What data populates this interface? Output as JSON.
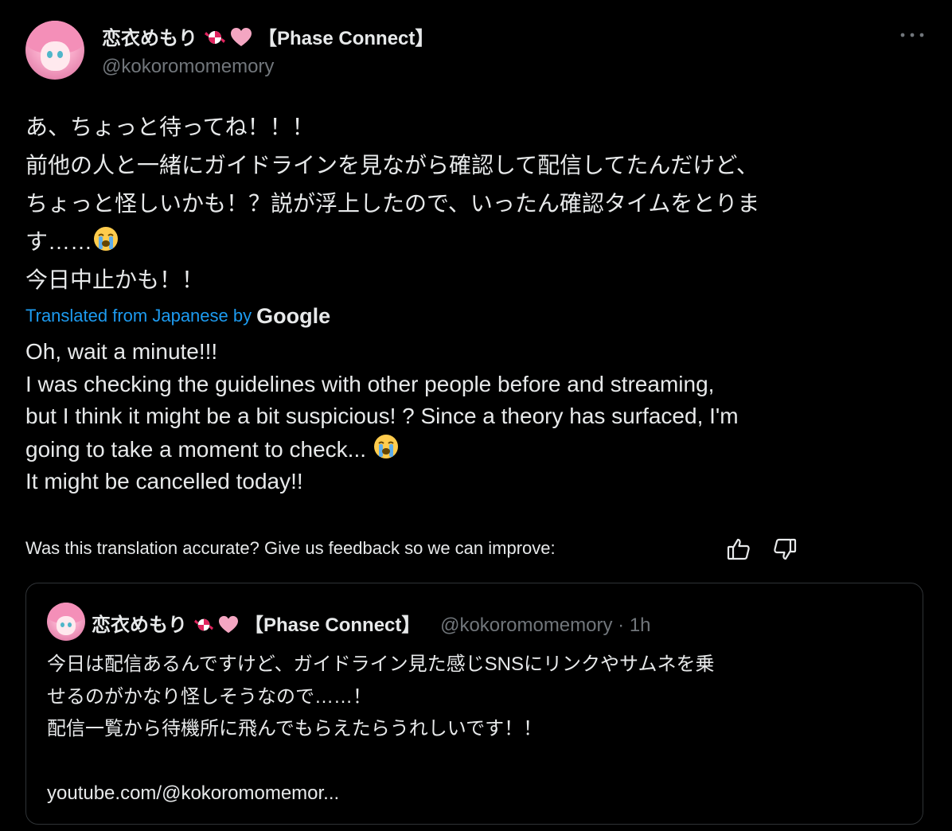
{
  "main": {
    "name": "恋衣めもり",
    "affiliation": "【Phase Connect】",
    "handle": "@kokoromomemory",
    "more_icon": "more-horizontal-icon",
    "text_lines": [
      "あ、ちょっと待ってね！！！",
      "前他の人と一緒にガイドラインを見ながら確認して配信してたんだけど、",
      "ちょっと怪しいかも！？説が浮上したので、いったん確認タイムをとりま",
      "す……",
      "今日中止かも！！"
    ],
    "translated_label": "Translated from Japanese by",
    "translated_provider": "Google",
    "translation_lines": [
      "Oh, wait a minute!!!",
      "I was checking the guidelines with other people before and streaming,",
      "but I think it might be a bit suspicious! ? Since a theory has surfaced, I'm",
      "going to take a moment to check...",
      "It might be cancelled today!!"
    ],
    "feedback_prompt": "Was this translation accurate? Give us feedback so we can improve:"
  },
  "quote": {
    "name": "恋衣めもり",
    "affiliation": "【Phase Connect】",
    "handle_time": "@kokoromomemory · 1h",
    "text_lines": [
      "今日は配信あるんですけど、ガイドライン見た感じSNSにリンクやサムネを乗",
      "せるのがかなり怪しそうなので……！",
      "配信一覧から待機所に飛んでもらえたらうれしいです！！",
      "",
      "youtube.com/@kokoromomemor..."
    ]
  },
  "colors": {
    "background": "#000000",
    "text": "#e7e9ea",
    "secondary": "#71767b",
    "link": "#1d9bf0",
    "border": "#2f3336"
  },
  "icons": {
    "candy": "candy-icon",
    "heart": "pink-heart-icon",
    "crying": "loudly-crying-face-icon",
    "thumbs_up": "thumbs-up-icon",
    "thumbs_down": "thumbs-down-icon"
  }
}
